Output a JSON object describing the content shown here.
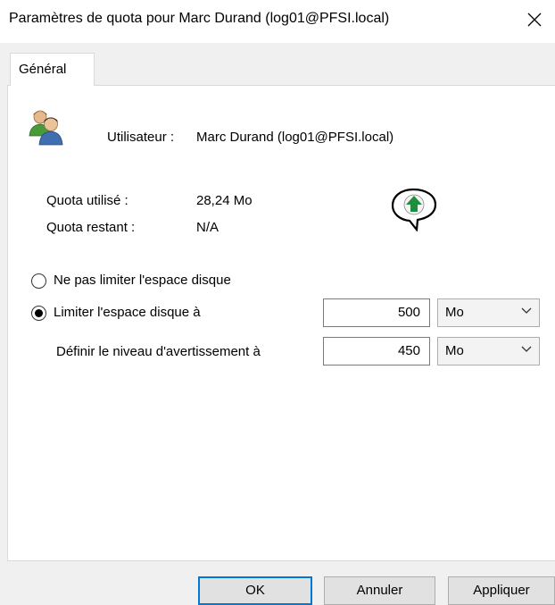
{
  "window": {
    "title": "Paramètres de quota pour Marc Durand (log01@PFSI.local)",
    "close_icon": "close-icon"
  },
  "tabs": [
    {
      "label": "Général",
      "active": true
    }
  ],
  "user": {
    "icon": "users-icon",
    "label": "Utilisateur :",
    "value": "Marc Durand (log01@PFSI.local)"
  },
  "quota": {
    "used_label": "Quota utilisé :",
    "used_value": "28,24 Mo",
    "remaining_label": "Quota restant :",
    "remaining_value": "N/A",
    "status_icon": "green-up-arrow-icon"
  },
  "options": {
    "no_limit_label": "Ne pas limiter l'espace disque",
    "no_limit_checked": false,
    "limit_label": "Limiter l'espace disque à",
    "limit_checked": true,
    "limit_value": "500",
    "limit_unit": "Mo",
    "warning_label": "Définir le niveau d'avertissement à",
    "warning_value": "450",
    "warning_unit": "Mo"
  },
  "buttons": {
    "ok": "OK",
    "cancel": "Annuler",
    "apply": "Appliquer"
  },
  "colors": {
    "accent": "#0078d7",
    "status_green": "#1e8e3e"
  }
}
